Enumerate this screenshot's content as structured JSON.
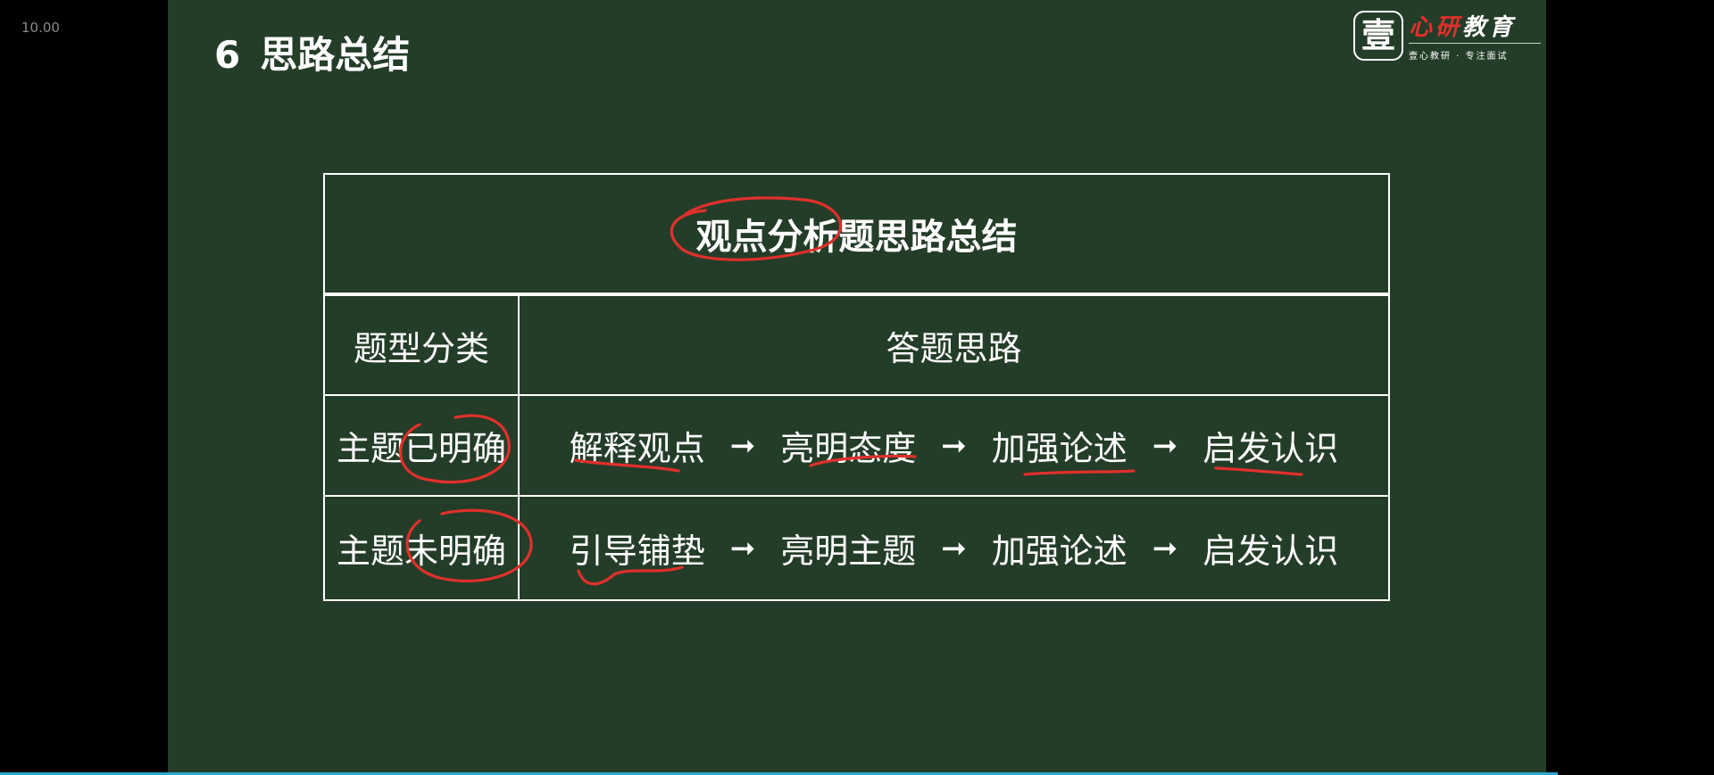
{
  "viewer": {
    "zoom_label": "10.00"
  },
  "slide": {
    "number": "6",
    "title": "思路总结",
    "background": "#243d28",
    "logo": {
      "seal_char": "壹",
      "name_red": "心研",
      "name_white": "教育",
      "tagline": "壹心教研 · 专注面试"
    }
  },
  "table": {
    "title": "观点分析题思路总结",
    "header": {
      "category": "题型分类",
      "approach": "答题思路"
    },
    "rows": [
      {
        "category": "主题已明确",
        "steps": [
          "解释观点",
          "亮明态度",
          "加强论述",
          "启发认识"
        ]
      },
      {
        "category": "主题未明确",
        "steps": [
          "引导铺垫",
          "亮明主题",
          "加强论述",
          "启发认识"
        ]
      }
    ],
    "arrow_glyph": "➞"
  },
  "annotation_color": "#e0302c"
}
